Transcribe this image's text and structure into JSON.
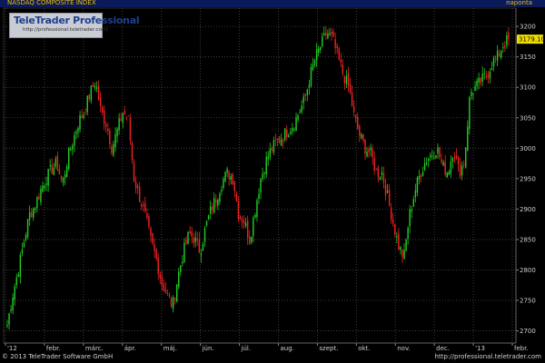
{
  "header": {
    "title": "NASDAQ COMPOSITE INDEX",
    "period": "napontа"
  },
  "logo": {
    "name": "TeleTrader Professional",
    "url": "http://professional.teletrader.com/"
  },
  "footer": {
    "copyright": "© 2013 TeleTrader Software GmbH",
    "url": "http://professional.teletrader.com"
  },
  "chart_data": {
    "type": "candlestick",
    "title": "NASDAQ COMPOSITE INDEX",
    "ylim": [
      2680,
      3230
    ],
    "y_ticks": [
      2700,
      2750,
      2800,
      2850,
      2900,
      2950,
      3000,
      3050,
      3100,
      3150,
      3200
    ],
    "x_tick_labels": [
      "'12",
      "febr.",
      "márc.",
      "ápr.",
      "máj.",
      "jún.",
      "júl.",
      "aug.",
      "szept.",
      "okt.",
      "nov.",
      "dec.",
      "'13",
      "febr."
    ],
    "last_value": "3179.10",
    "colors": {
      "up": "#22cc22",
      "down": "#ee2222",
      "grid": "#4a4a4a",
      "axis_text": "#d0d0d0",
      "last_label_bg": "#f0e000"
    },
    "closes": [
      2710,
      2760,
      2800,
      2845,
      2890,
      2905,
      2930,
      2950,
      2965,
      2975,
      2940,
      2985,
      3015,
      3045,
      3060,
      3090,
      3110,
      3060,
      3040,
      3000,
      3030,
      3060,
      3045,
      2950,
      2920,
      2890,
      2850,
      2820,
      2780,
      2760,
      2740,
      2790,
      2830,
      2860,
      2850,
      2830,
      2870,
      2900,
      2920,
      2945,
      2960,
      2950,
      2890,
      2880,
      2850,
      2900,
      2950,
      2980,
      3000,
      3010,
      3020,
      3030,
      3040,
      3060,
      3080,
      3120,
      3150,
      3170,
      3190,
      3180,
      3150,
      3120,
      3100,
      3050,
      3020,
      3000,
      2990,
      2960,
      2960,
      2920,
      2880,
      2840,
      2820,
      2890,
      2930,
      2960,
      2980,
      2990,
      3000,
      2970,
      2960,
      3000,
      2960,
      2980,
      3090,
      3100,
      3110,
      3120,
      3140,
      3150,
      3170,
      3179.1
    ]
  }
}
